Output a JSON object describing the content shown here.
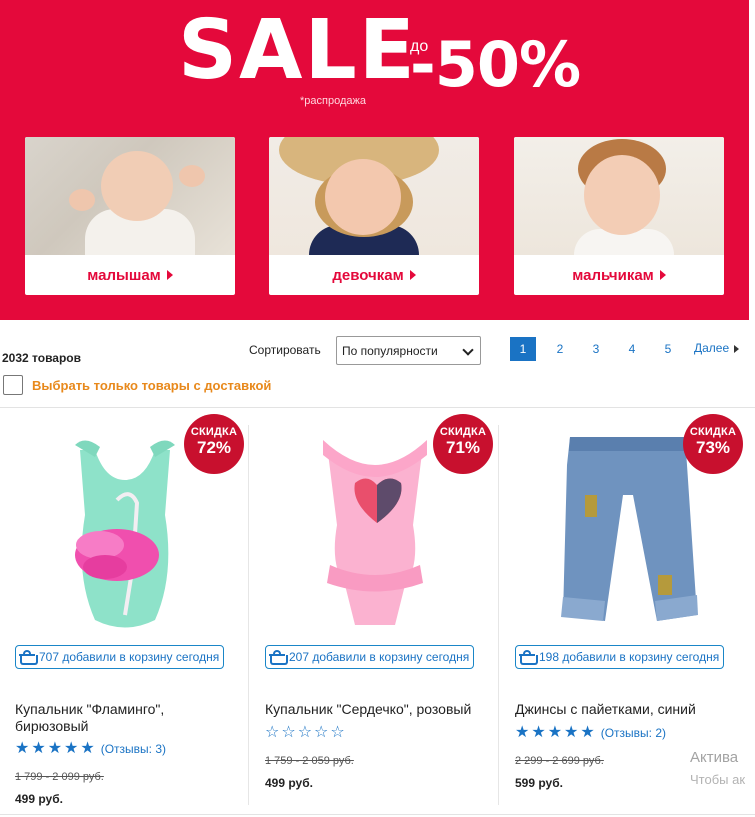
{
  "banner": {
    "sale_word": "SALE",
    "sale_star": "*",
    "sale_do": "до",
    "sale_pct": "-50%",
    "note": "*распродажа",
    "bg_color": "#e4093b",
    "categories": [
      {
        "label": "малышам"
      },
      {
        "label": "девочкам"
      },
      {
        "label": "мальчикам"
      }
    ]
  },
  "toolbar": {
    "count": "2032 товаров",
    "sort_label": "Сортировать",
    "sort_value": "По популярности",
    "pages": [
      "1",
      "2",
      "3",
      "4",
      "5"
    ],
    "active_page": "1",
    "next_label": "Далее",
    "delivery_label": "Выбрать только товары с доставкой"
  },
  "products": [
    {
      "badge_top": "СКИДКА",
      "badge_pct": "72%",
      "cart_text": "707 добавили в корзину сегодня",
      "name_line1": "Купальник \"Фламинго\",",
      "name_line2": "бирюзовый",
      "stars_filled": 5,
      "reviews": "(Отзывы: 3)",
      "old_price": "1 799 - 2 099 руб.",
      "price": "499 руб."
    },
    {
      "badge_top": "СКИДКА",
      "badge_pct": "71%",
      "cart_text": "207 добавили в корзину сегодня",
      "name_line1": "Купальник \"Сердечко\", розовый",
      "name_line2": "",
      "stars_filled": 0,
      "reviews": "",
      "old_price": "1 759 - 2 059 руб.",
      "price": "499 руб."
    },
    {
      "badge_top": "СКИДКА",
      "badge_pct": "73%",
      "cart_text": "198 добавили в корзину сегодня",
      "name_line1": "Джинсы с пайетками, синий",
      "name_line2": "",
      "stars_filled": 5,
      "reviews": "(Отзывы: 2)",
      "old_price": "2 299 - 2 699 руб.",
      "price": "599 руб."
    }
  ],
  "watermark": {
    "line1": "Актива",
    "line2": "Чтобы ак"
  }
}
